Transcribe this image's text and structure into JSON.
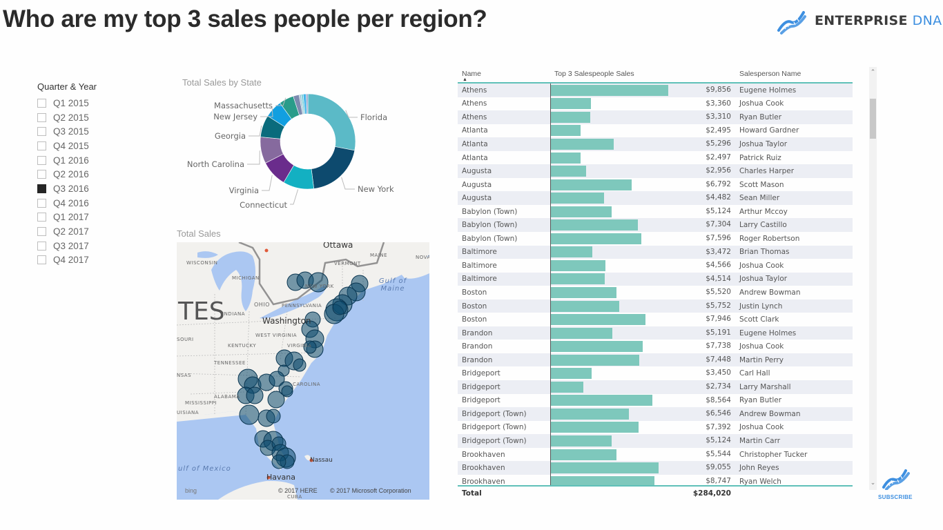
{
  "header": {
    "title": "Who are my top 3 sales people per region?",
    "brand_main": "ENTERPRISE",
    "brand_accent": "DNA",
    "brand_icon": "dna-helix-icon"
  },
  "slicer": {
    "title": "Quarter & Year",
    "items": [
      {
        "label": "Q1 2015",
        "checked": false
      },
      {
        "label": "Q2 2015",
        "checked": false
      },
      {
        "label": "Q3 2015",
        "checked": false
      },
      {
        "label": "Q4 2015",
        "checked": false
      },
      {
        "label": "Q1 2016",
        "checked": false
      },
      {
        "label": "Q2 2016",
        "checked": false
      },
      {
        "label": "Q3 2016",
        "checked": true
      },
      {
        "label": "Q4 2016",
        "checked": false
      },
      {
        "label": "Q1 2017",
        "checked": false
      },
      {
        "label": "Q2 2017",
        "checked": false
      },
      {
        "label": "Q3 2017",
        "checked": false
      },
      {
        "label": "Q4 2017",
        "checked": false
      }
    ]
  },
  "chart_data": {
    "type": "pie",
    "title": "Total Sales by State",
    "donut": true,
    "legend": "none (outside data labels)",
    "slices": [
      {
        "label": "Florida",
        "value": 28,
        "color": "#5bbac7"
      },
      {
        "label": "New York",
        "value": 20,
        "color": "#0d4a6e"
      },
      {
        "label": "Connecticut",
        "value": 10.5,
        "color": "#13b0c2"
      },
      {
        "label": "Virginia",
        "value": 9,
        "color": "#6a2c8c"
      },
      {
        "label": "North Carolina",
        "value": 9,
        "color": "#866a9e"
      },
      {
        "label": "Georgia",
        "value": 7.5,
        "color": "#0a6b7c"
      },
      {
        "label": "New Jersey",
        "value": 6,
        "color": "#129fe0"
      },
      {
        "label": "Massachusetts",
        "value": 5,
        "color": "#2a9c8a"
      },
      {
        "label": "",
        "value": 2,
        "color": "#7d8bb0"
      },
      {
        "label": "",
        "value": 0.7,
        "color": "#a6c8d8"
      },
      {
        "label": "",
        "value": 0.7,
        "color": "#7fd0dc"
      },
      {
        "label": "",
        "value": 1,
        "color": "#44b5ea"
      },
      {
        "label": "",
        "value": 0.6,
        "color": "#9aa0c8"
      }
    ]
  },
  "map": {
    "title": "Total Sales",
    "labels": {
      "ottawa": "Ottawa",
      "washington": "Washington",
      "nassau": "Nassau",
      "havana": "Havana",
      "wisconsin": "WISCONSIN",
      "michigan": "MICHIGAN",
      "ohio": "OHIO",
      "indiana": "INDIANA",
      "pennsylvania": "PENNSYLVANIA",
      "new_york": "NEW YORK",
      "vermont": "VERMONT",
      "maine": "MAINE",
      "nova": "NOVA",
      "west_virginia": "WEST VIRGINIA",
      "kentucky": "KENTUCKY",
      "virginia": "VIRGINIA",
      "tennessee": "TENNESSEE",
      "souri": "SOURI",
      "nsas": "NSAS",
      "alabama": "ALABAMA",
      "mississippi": "MISSISSIPPI",
      "uisiana": "UISIANA",
      "carolina": "CAROLINA",
      "cuba": "CUBA",
      "tes": "TES",
      "gulf_maine": "Gulf of Maine",
      "gulf_mexico": "ulf of Mexico"
    },
    "copyright_here": "© 2017 HERE",
    "copyright_ms": "© 2017 Microsoft Corporation",
    "bing": "bing"
  },
  "table": {
    "columns": [
      "Name",
      "Top 3 Salespeople Sales",
      "Salesperson Name"
    ],
    "sort": "Name ascending",
    "max_value": 10000,
    "rows": [
      {
        "name": "Athens",
        "sales": 9856,
        "sales_label": "$9,856",
        "person": "Eugene Holmes"
      },
      {
        "name": "Athens",
        "sales": 3360,
        "sales_label": "$3,360",
        "person": "Joshua Cook"
      },
      {
        "name": "Athens",
        "sales": 3310,
        "sales_label": "$3,310",
        "person": "Ryan Butler"
      },
      {
        "name": "Atlanta",
        "sales": 2495,
        "sales_label": "$2,495",
        "person": "Howard Gardner"
      },
      {
        "name": "Atlanta",
        "sales": 5296,
        "sales_label": "$5,296",
        "person": "Joshua Taylor"
      },
      {
        "name": "Atlanta",
        "sales": 2497,
        "sales_label": "$2,497",
        "person": "Patrick Ruiz"
      },
      {
        "name": "Augusta",
        "sales": 2956,
        "sales_label": "$2,956",
        "person": "Charles Harper"
      },
      {
        "name": "Augusta",
        "sales": 6792,
        "sales_label": "$6,792",
        "person": "Scott Mason"
      },
      {
        "name": "Augusta",
        "sales": 4482,
        "sales_label": "$4,482",
        "person": "Sean Miller"
      },
      {
        "name": "Babylon (Town)",
        "sales": 5124,
        "sales_label": "$5,124",
        "person": "Arthur Mccoy"
      },
      {
        "name": "Babylon (Town)",
        "sales": 7304,
        "sales_label": "$7,304",
        "person": "Larry Castillo"
      },
      {
        "name": "Babylon (Town)",
        "sales": 7596,
        "sales_label": "$7,596",
        "person": "Roger Robertson"
      },
      {
        "name": "Baltimore",
        "sales": 3472,
        "sales_label": "$3,472",
        "person": "Brian Thomas"
      },
      {
        "name": "Baltimore",
        "sales": 4566,
        "sales_label": "$4,566",
        "person": "Joshua Cook"
      },
      {
        "name": "Baltimore",
        "sales": 4514,
        "sales_label": "$4,514",
        "person": "Joshua Taylor"
      },
      {
        "name": "Boston",
        "sales": 5520,
        "sales_label": "$5,520",
        "person": "Andrew Bowman"
      },
      {
        "name": "Boston",
        "sales": 5752,
        "sales_label": "$5,752",
        "person": "Justin Lynch"
      },
      {
        "name": "Boston",
        "sales": 7946,
        "sales_label": "$7,946",
        "person": "Scott Clark"
      },
      {
        "name": "Brandon",
        "sales": 5191,
        "sales_label": "$5,191",
        "person": "Eugene Holmes"
      },
      {
        "name": "Brandon",
        "sales": 7738,
        "sales_label": "$7,738",
        "person": "Joshua Cook"
      },
      {
        "name": "Brandon",
        "sales": 7448,
        "sales_label": "$7,448",
        "person": "Martin Perry"
      },
      {
        "name": "Bridgeport",
        "sales": 3450,
        "sales_label": "$3,450",
        "person": "Carl Hall"
      },
      {
        "name": "Bridgeport",
        "sales": 2734,
        "sales_label": "$2,734",
        "person": "Larry Marshall"
      },
      {
        "name": "Bridgeport",
        "sales": 8564,
        "sales_label": "$8,564",
        "person": "Ryan Butler"
      },
      {
        "name": "Bridgeport (Town)",
        "sales": 6546,
        "sales_label": "$6,546",
        "person": "Andrew Bowman"
      },
      {
        "name": "Bridgeport (Town)",
        "sales": 7392,
        "sales_label": "$7,392",
        "person": "Joshua Cook"
      },
      {
        "name": "Bridgeport (Town)",
        "sales": 5124,
        "sales_label": "$5,124",
        "person": "Martin Carr"
      },
      {
        "name": "Brookhaven",
        "sales": 5544,
        "sales_label": "$5,544",
        "person": "Christopher Tucker"
      },
      {
        "name": "Brookhaven",
        "sales": 9055,
        "sales_label": "$9,055",
        "person": "John Reyes"
      },
      {
        "name": "Brookhaven",
        "sales": 8747,
        "sales_label": "$8,747",
        "person": "Ryan Welch"
      }
    ],
    "total_label": "Total",
    "total_value": "$284,020"
  },
  "subscribe": {
    "label": "SUBSCRIBE"
  },
  "colors": {
    "bar": "#7ec8bc",
    "accent": "#5fc0b8",
    "brand_blue": "#3d8fe0",
    "bubble": "#0d4a6e"
  }
}
